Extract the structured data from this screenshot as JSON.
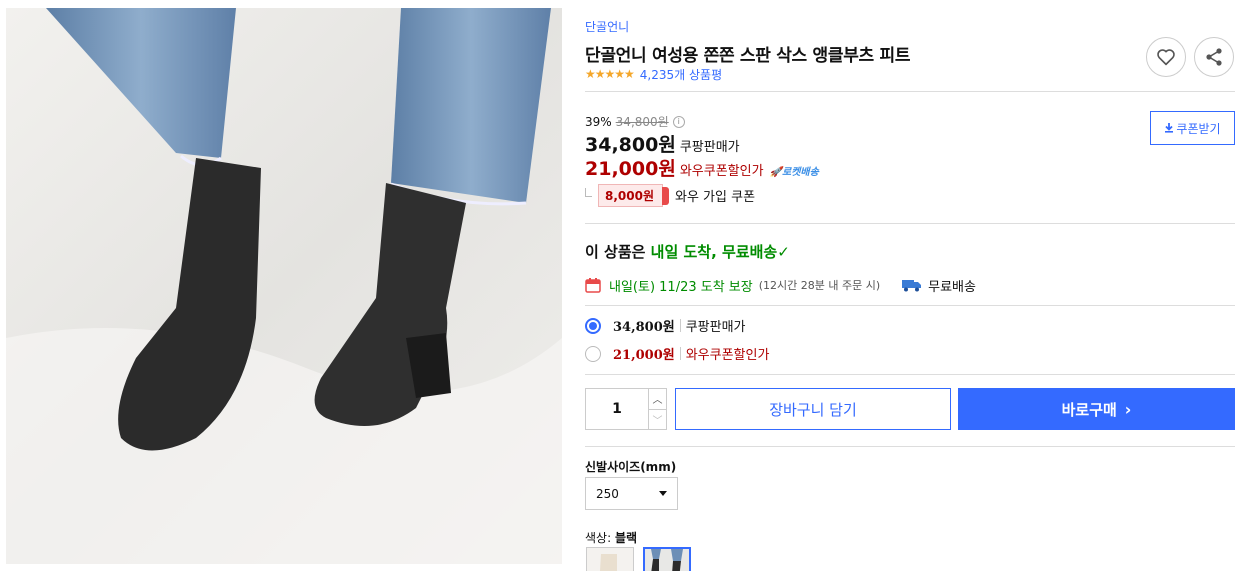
{
  "product": {
    "brand": "단골언니",
    "title": "단골언니 여성용 쫀쫀 스판 삭스 앵클부츠 피트",
    "rating": 4.5,
    "rating_stars": "★★★★★",
    "review_count": "4,235개 상품평"
  },
  "price": {
    "discount_rate": "39%",
    "original_price": "34,800원",
    "info_icon": "i",
    "sale_price": "34,800원",
    "sale_label": "쿠팡판매가",
    "wow_price": "21,000원",
    "wow_label": "와우쿠폰할인가",
    "rocket_badge": "🚀로켓배송",
    "coupon_amount": "8,000원",
    "coupon_text": "와우 가입 쿠폰",
    "coupon_button": "쿠폰받기"
  },
  "delivery": {
    "head_prefix": "이 상품은 ",
    "head_highlight": "내일 도착, 무료배송",
    "head_check": "✓",
    "arrival": "내일(토) 11/23 도착 보장",
    "arrival_sub": "(12시간 28분 내 주문 시)",
    "free_shipping": "무료배송"
  },
  "options": [
    {
      "price": "34,800원",
      "label": "쿠팡판매가",
      "selected": true
    },
    {
      "price": "21,000원",
      "label": "와우쿠폰할인가",
      "selected": false
    }
  ],
  "purchase": {
    "quantity": "1",
    "cart_button": "장바구니 담기",
    "buy_button": "바로구매",
    "buy_chevron": "›"
  },
  "size": {
    "label": "신발사이즈(mm)",
    "selected": "250"
  },
  "color": {
    "label_prefix": "색상: ",
    "selected": "블랙"
  },
  "colors": {
    "accent": "#346aff",
    "wow_red": "#ae0000",
    "delivery_green": "#008c00",
    "star": "#f4a62a"
  },
  "icons": [
    "heart-icon",
    "share-icon",
    "info-icon",
    "download-icon",
    "calendar-icon",
    "truck-icon",
    "check-icon",
    "caret-down-icon",
    "chevron-right-icon"
  ]
}
